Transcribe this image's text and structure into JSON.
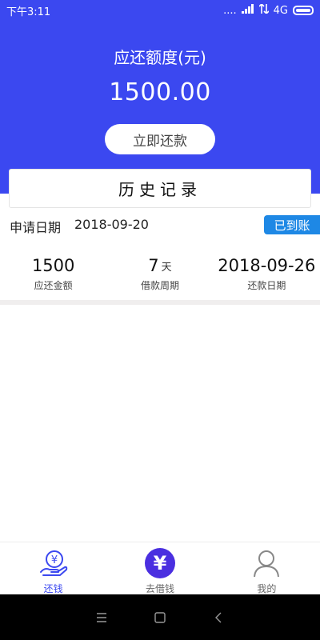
{
  "status_bar": {
    "time": "下午3:11",
    "signal_text": "....",
    "network": "4G"
  },
  "header": {
    "amount_label": "应还额度(元)",
    "amount_value": "1500.00",
    "repay_button": "立即还款"
  },
  "history": {
    "title": "历史记录"
  },
  "record": {
    "apply_label": "申请日期",
    "apply_date": "2018-09-20",
    "status_badge": "已到账",
    "stats": [
      {
        "value": "1500",
        "unit": "",
        "label": "应还金额"
      },
      {
        "value": "7",
        "unit": "天",
        "label": "借款周期"
      },
      {
        "value": "2018-09-26",
        "unit": "",
        "label": "还款日期"
      }
    ]
  },
  "tabbar": {
    "tabs": [
      {
        "label": "还钱",
        "icon": "hand-yen-icon"
      },
      {
        "label": "去借钱",
        "icon": "yen-coin-icon"
      },
      {
        "label": "我的",
        "icon": "user-icon"
      }
    ]
  },
  "colors": {
    "primary": "#3b48f0",
    "badge": "#1e88e5",
    "coin": "#4a2fe0"
  }
}
